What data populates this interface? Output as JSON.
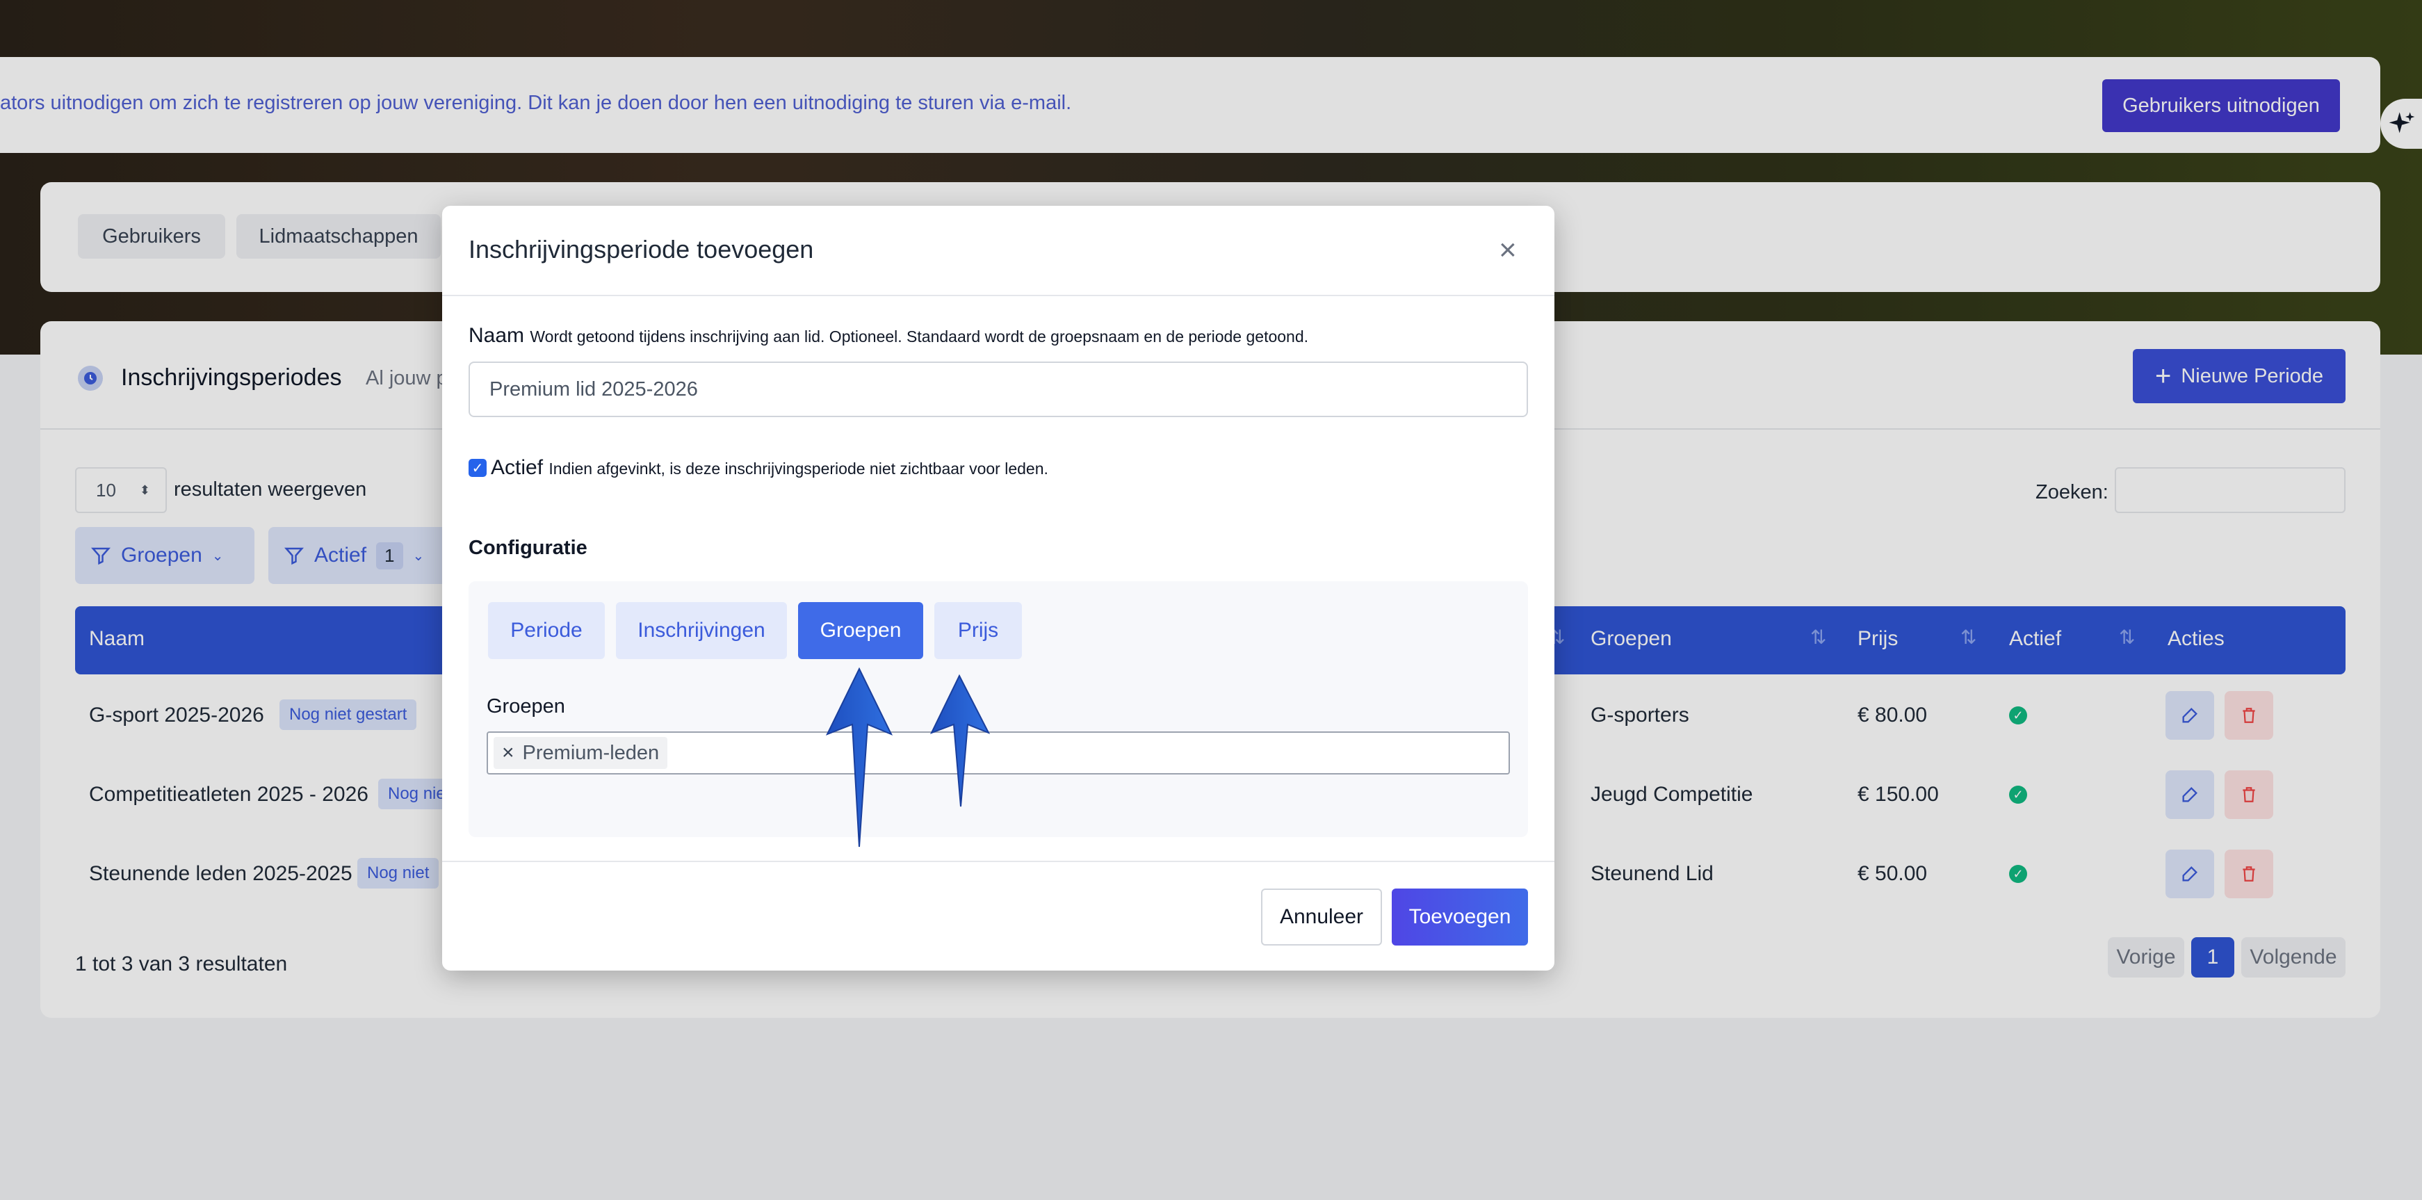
{
  "notice": {
    "text": "ators uitnodigen om zich te registreren op jouw vereniging. Dit kan je doen door hen een uitnodiging te sturen via e-mail.",
    "invite_button": "Gebruikers uitnodigen"
  },
  "nav_tabs": [
    "Gebruikers",
    "Lidmaatschappen"
  ],
  "section": {
    "title": "Inschrijvingsperiodes",
    "subtitle": "Al jouw p",
    "new_button": "Nieuwe Periode"
  },
  "table_controls": {
    "page_size": "10",
    "page_size_label": "resultaten weergeven",
    "search_label": "Zoeken:",
    "search_value": "",
    "filters": [
      {
        "label": "Groepen",
        "count": ""
      },
      {
        "label": "Actief",
        "count": "1"
      }
    ]
  },
  "table": {
    "columns": [
      "Naam",
      "Groepen",
      "Prijs",
      "Actief",
      "Acties"
    ],
    "rows": [
      {
        "name": "G-sport 2025-2026",
        "status": "Nog niet gestart",
        "groups": "G-sporters",
        "price": "€ 80.00"
      },
      {
        "name": "Competitieatleten 2025 - 2026",
        "status": "Nog nie",
        "groups": "Jeugd Competitie",
        "price": "€ 150.00"
      },
      {
        "name": "Steunende leden 2025-2025",
        "status": "Nog niet",
        "groups": "Steunend Lid",
        "price": "€ 50.00"
      }
    ],
    "summary": "1 tot 3 van 3 resultaten",
    "pagination": {
      "prev": "Vorige",
      "current": "1",
      "next": "Volgende"
    }
  },
  "modal": {
    "title": "Inschrijvingsperiode toevoegen",
    "name_label": "Naam",
    "name_help": "Wordt getoond tijdens inschrijving aan lid. Optioneel. Standaard wordt de groepsnaam en de periode getoond.",
    "name_value": "Premium lid 2025-2026",
    "active_label": "Actief",
    "active_help": "Indien afgevinkt, is deze inschrijvingsperiode niet zichtbaar voor leden.",
    "active_checked": true,
    "config_title": "Configuratie",
    "config_tabs": [
      "Periode",
      "Inschrijvingen",
      "Groepen",
      "Prijs"
    ],
    "active_tab": "Groepen",
    "groups_label": "Groepen",
    "selected_groups": [
      "Premium-leden"
    ],
    "cancel_button": "Annuleer",
    "submit_button": "Toevoegen"
  },
  "colors": {
    "primary": "#2f55d4",
    "accent": "#3f6be8",
    "invite": "#4338ca",
    "success": "#10b981",
    "danger": "#ef4444"
  }
}
